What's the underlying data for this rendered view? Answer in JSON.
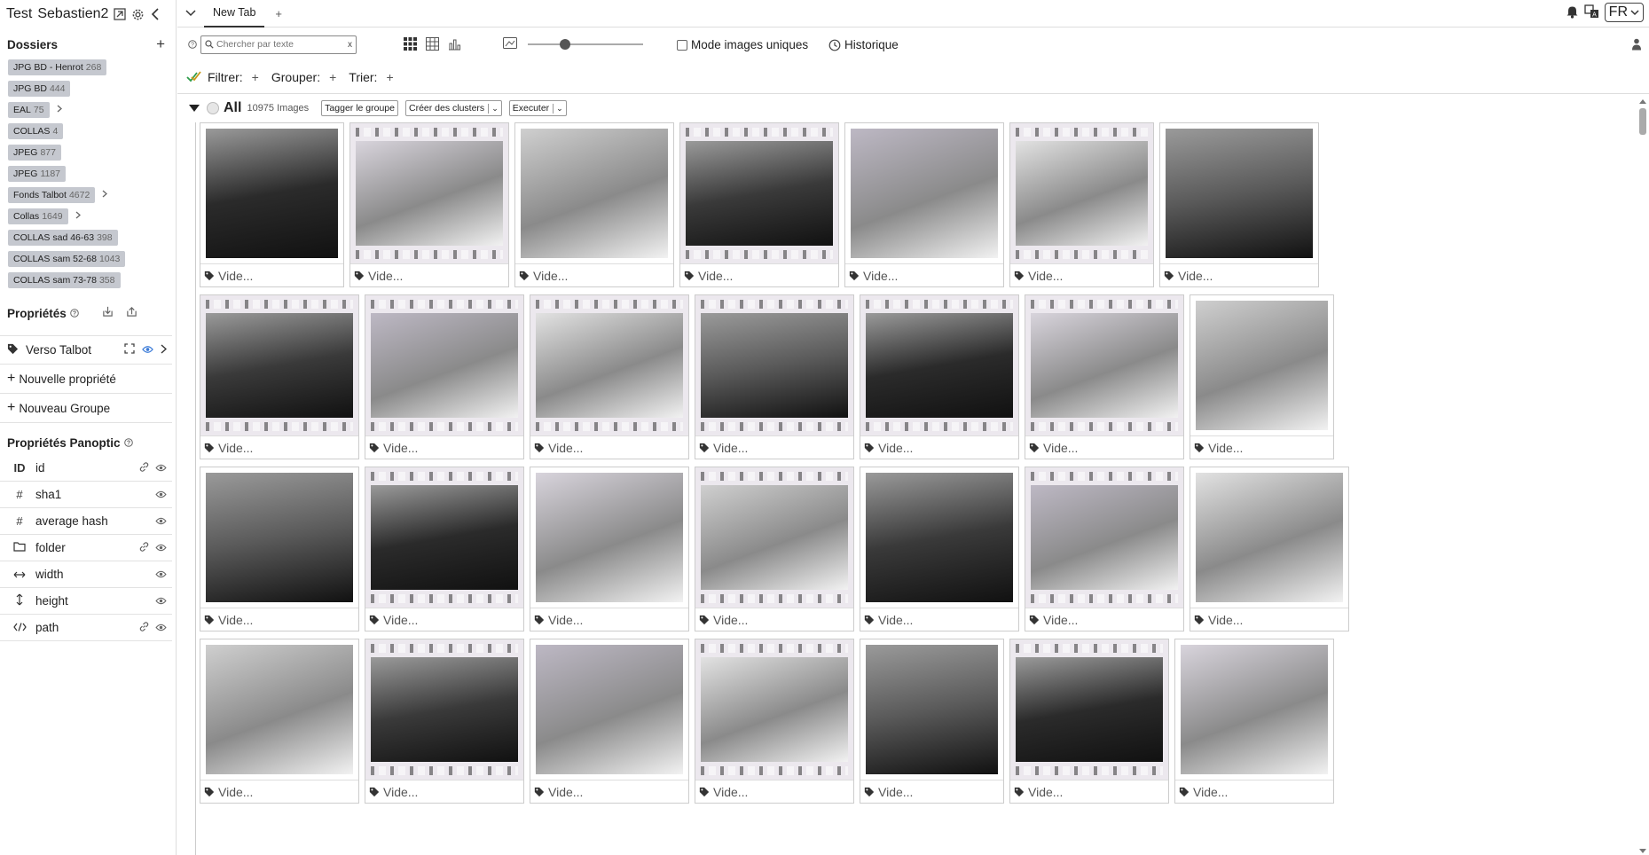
{
  "project": {
    "title": "Test",
    "user": "Sebastien2"
  },
  "folders": {
    "title": "Dossiers",
    "items": [
      {
        "name": "JPG BD - Henrot",
        "count": "268",
        "expandable": false
      },
      {
        "name": "JPG BD",
        "count": "444",
        "expandable": false
      },
      {
        "name": "EAL",
        "count": "75",
        "expandable": true
      },
      {
        "name": "COLLAS",
        "count": "4",
        "expandable": false
      },
      {
        "name": "JPEG",
        "count": "877",
        "expandable": false
      },
      {
        "name": "JPEG",
        "count": "1187",
        "expandable": false
      },
      {
        "name": "Fonds Talbot",
        "count": "4672",
        "expandable": true
      },
      {
        "name": "Collas",
        "count": "1649",
        "expandable": true
      },
      {
        "name": "COLLAS sad 46-63",
        "count": "398",
        "expandable": false
      },
      {
        "name": "COLLAS sam 52-68",
        "count": "1043",
        "expandable": false
      },
      {
        "name": "COLLAS sam 73-78",
        "count": "358",
        "expandable": false
      }
    ]
  },
  "properties": {
    "title": "Propriétés",
    "items": [
      {
        "name": "Verso Talbot"
      }
    ],
    "new_property": "Nouvelle propriété",
    "new_group": "Nouveau Groupe"
  },
  "panoptic": {
    "title": "Propriétés Panoptic",
    "items": [
      {
        "icon": "ID",
        "name": "id",
        "link": true
      },
      {
        "icon": "#",
        "name": "sha1",
        "link": false
      },
      {
        "icon": "#",
        "name": "average hash",
        "link": false
      },
      {
        "icon": "folder",
        "name": "folder",
        "link": true
      },
      {
        "icon": "width",
        "name": "width",
        "link": false
      },
      {
        "icon": "height",
        "name": "height",
        "link": false
      },
      {
        "icon": "code",
        "name": "path",
        "link": true
      }
    ]
  },
  "tabs": {
    "items": [
      {
        "label": "New Tab",
        "active": true
      }
    ],
    "add": "+"
  },
  "language": "FR",
  "toolbar": {
    "search_placeholder": "Chercher par texte",
    "search_clear": "x",
    "zoom_level": 0.32,
    "mode_label": "Mode images uniques",
    "history_label": "Historique"
  },
  "filterbar": {
    "filter": "Filtrer:",
    "group": "Grouper:",
    "sort": "Trier:",
    "add": "+"
  },
  "group": {
    "name": "All",
    "count": "10975 Images",
    "tag_button": "Tagger le groupe",
    "cluster_button": "Créer des clusters",
    "execute_button": "Executer"
  },
  "image_label": "Vide...",
  "grid_rows": [
    {
      "widths": [
        163,
        180,
        180,
        180,
        180,
        163,
        180
      ]
    },
    {
      "widths": [
        180,
        180,
        180,
        180,
        180,
        180,
        163
      ]
    },
    {
      "widths": [
        180,
        180,
        180,
        180,
        180,
        180,
        180
      ]
    },
    {
      "widths": [
        180,
        180,
        180,
        180,
        163,
        180,
        180
      ]
    }
  ]
}
